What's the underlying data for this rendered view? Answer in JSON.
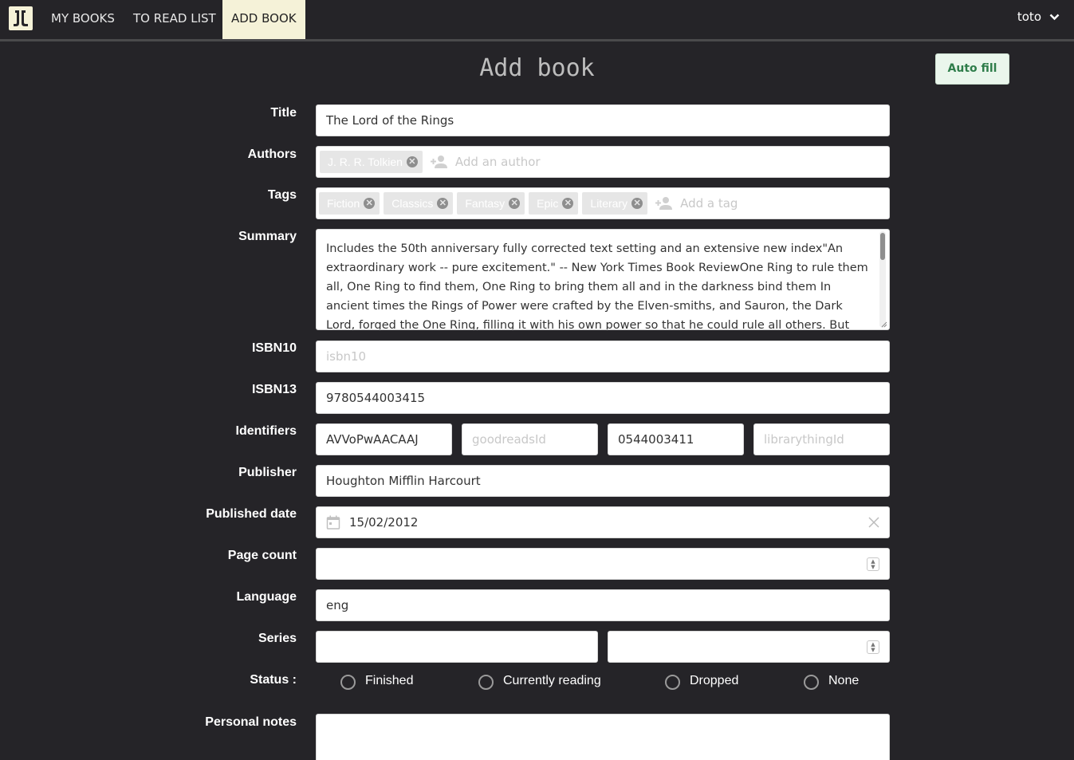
{
  "nav": {
    "items": [
      "MY BOOKS",
      "TO READ LIST",
      "ADD BOOK"
    ],
    "user": "toto"
  },
  "page": {
    "title": "Add book",
    "autofill_label": "Auto fill"
  },
  "form": {
    "labels": {
      "title": "Title",
      "authors": "Authors",
      "tags": "Tags",
      "summary": "Summary",
      "isbn10": "ISBN10",
      "isbn13": "ISBN13",
      "identifiers": "Identifiers",
      "publisher": "Publisher",
      "published_date": "Published date",
      "page_count": "Page count",
      "language": "Language",
      "series": "Series",
      "status": "Status :",
      "personal_notes": "Personal notes"
    },
    "title_value": "The Lord of the Rings",
    "authors": [
      "J. R. R. Tolkien"
    ],
    "authors_placeholder": "Add an author",
    "tags": [
      "Fiction",
      "Classics",
      "Fantasy",
      "Epic",
      "Literary"
    ],
    "tags_placeholder": "Add a tag",
    "summary_value": "Includes the 50th anniversary fully corrected text setting and an extensive new index\"An extraordinary work -- pure excitement.\" -- New York Times Book ReviewOne Ring to rule them all, One Ring to find them, One Ring to bring them all and in the darkness bind them In ancient times the Rings of Power were crafted by the Elven-smiths, and Sauron, the Dark Lord, forged the One Ring, filling it with his own power so that he could rule all others. But the One Ring was",
    "isbn10_placeholder": "isbn10",
    "isbn13_value": "9780544003415",
    "identifiers": {
      "google": "AVVoPwAACAAJ",
      "goodreads_placeholder": "goodreadsId",
      "amazon": "0544003411",
      "librarything_placeholder": "librarythingId"
    },
    "publisher_value": "Houghton Mifflin Harcourt",
    "published_date_value": "15/02/2012",
    "page_count_value": "",
    "language_value": "eng",
    "series_name_value": "",
    "series_number_value": "",
    "status_options": [
      "Finished",
      "Currently reading",
      "Dropped",
      "None"
    ],
    "personal_notes_value": ""
  },
  "colors": {
    "background": "#252428",
    "nav_active": "#f5f2d8",
    "autofill_text": "#2e7d4a"
  }
}
